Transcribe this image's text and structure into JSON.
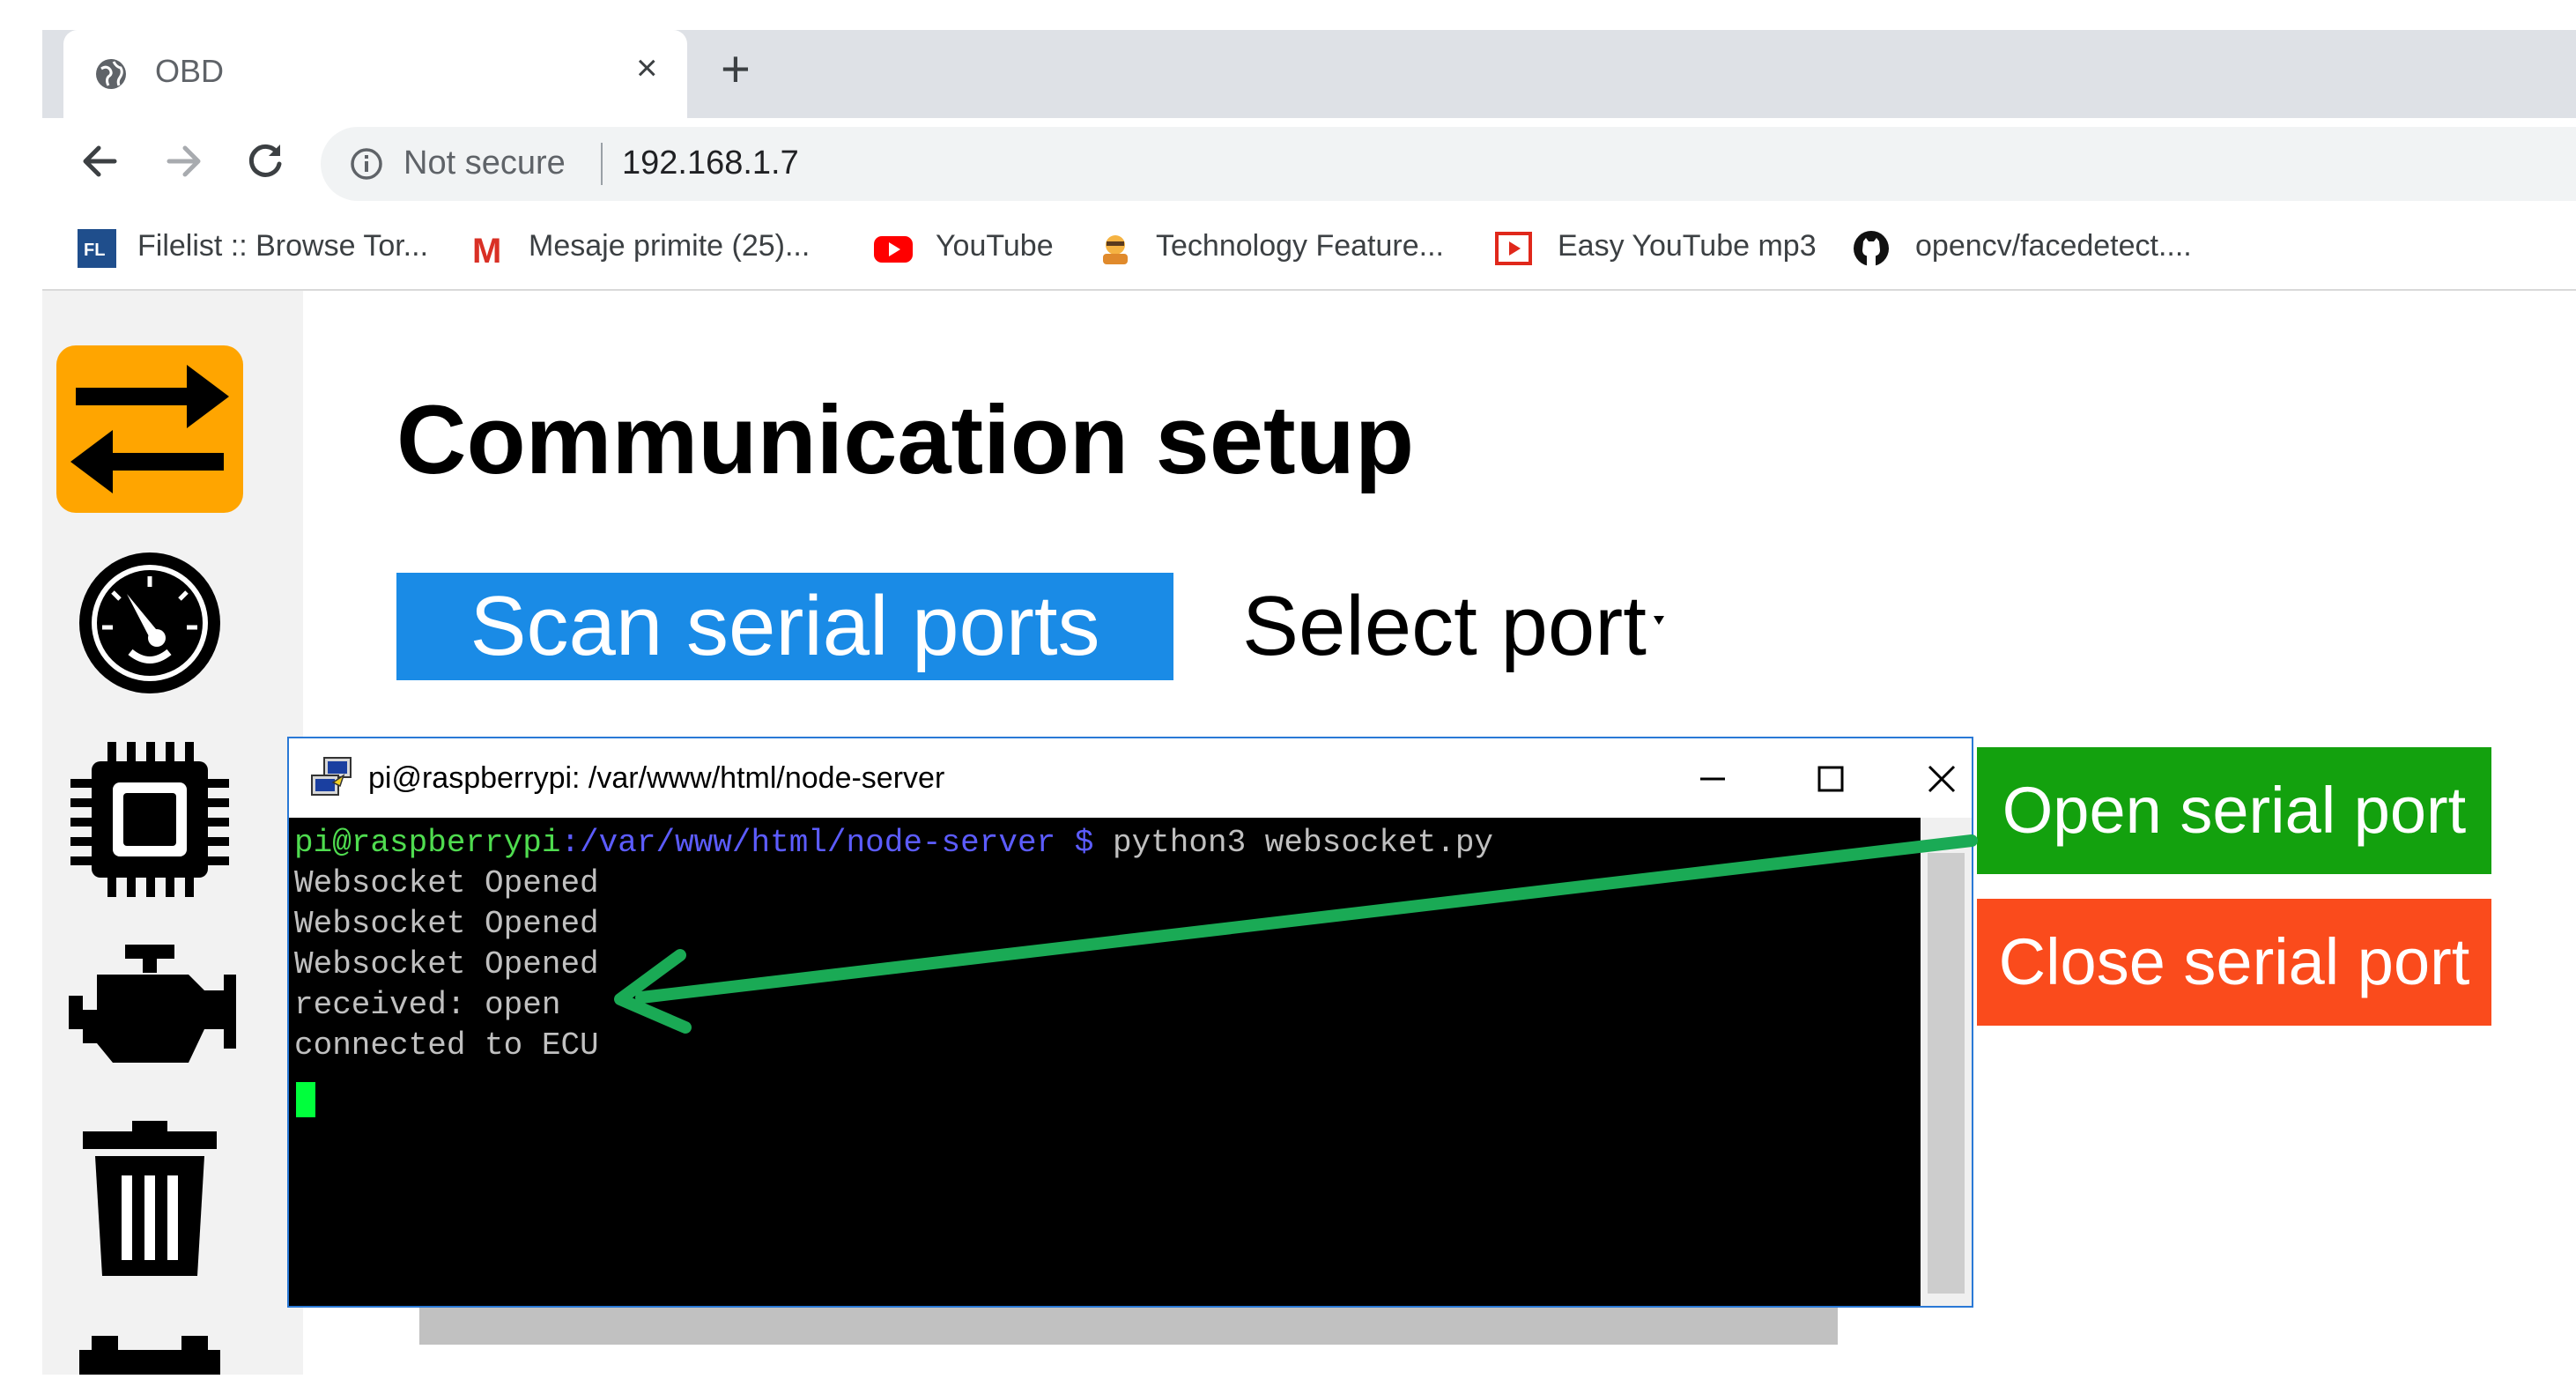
{
  "browser": {
    "tab_title": "OBD",
    "close_glyph": "×",
    "new_tab_glyph": "+",
    "not_secure_label": "Not secure",
    "url": "192.168.1.7",
    "bookmarks": [
      {
        "label": "Filelist :: Browse Tor...",
        "icon": "filelist-icon",
        "icon_text": "FL"
      },
      {
        "label": "Mesaje primite (25)...",
        "icon": "gmail-icon",
        "icon_text": "M"
      },
      {
        "label": "YouTube",
        "icon": "youtube-icon"
      },
      {
        "label": "Technology Feature...",
        "icon": "technology-icon"
      },
      {
        "label": "Easy YouTube mp3",
        "icon": "easy-youtube-icon"
      },
      {
        "label": "opencv/facedetect....",
        "icon": "github-icon"
      }
    ]
  },
  "sidebar": {
    "items": [
      {
        "name": "communication",
        "icon": "swap-arrows-icon",
        "active": true
      },
      {
        "name": "gauges",
        "icon": "gauge-icon"
      },
      {
        "name": "ecu",
        "icon": "chip-icon"
      },
      {
        "name": "engine",
        "icon": "engine-icon"
      },
      {
        "name": "clear",
        "icon": "trash-icon"
      },
      {
        "name": "more",
        "icon": "battery-icon"
      }
    ]
  },
  "main": {
    "title": "Communication setup",
    "scan_button": "Scan serial ports",
    "select_port": "Select port",
    "open_button": "Open serial port",
    "close_button": "Close serial port"
  },
  "terminal": {
    "title": "pi@raspberrypi: /var/www/html/node-server",
    "prompt_user": "pi@raspberrypi",
    "prompt_path": ":/var/www/html/node-server $",
    "prompt_command": " python3 websocket.py",
    "lines": [
      "Websocket Opened",
      "Websocket Opened",
      "Websocket Opened",
      "received: open",
      "connected to ECU"
    ]
  },
  "colors": {
    "active_orange": "#ffa500",
    "scan_blue": "#1a8be6",
    "open_green": "#13a10e",
    "close_red": "#fa4b1c",
    "annotation_arrow": "#1aaa55",
    "cursor_green": "#00ff3c"
  }
}
